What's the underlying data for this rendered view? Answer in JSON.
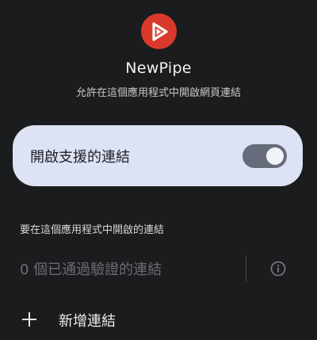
{
  "app": {
    "name": "NewPipe",
    "subtitle": "允許在這個應用程式中開啟網頁連結",
    "icon": "newpipe-logo",
    "brand_color": "#d9392b"
  },
  "toggle": {
    "label": "開啟支援的連結",
    "enabled": true,
    "card_color": "#dde3f4"
  },
  "links_section": {
    "title": "要在這個應用程式中開啟的連結",
    "verified_text": "0 個已通過驗證的連結",
    "info_icon": "info-icon"
  },
  "add_link": {
    "label": "新增連結",
    "icon": "plus-icon"
  }
}
